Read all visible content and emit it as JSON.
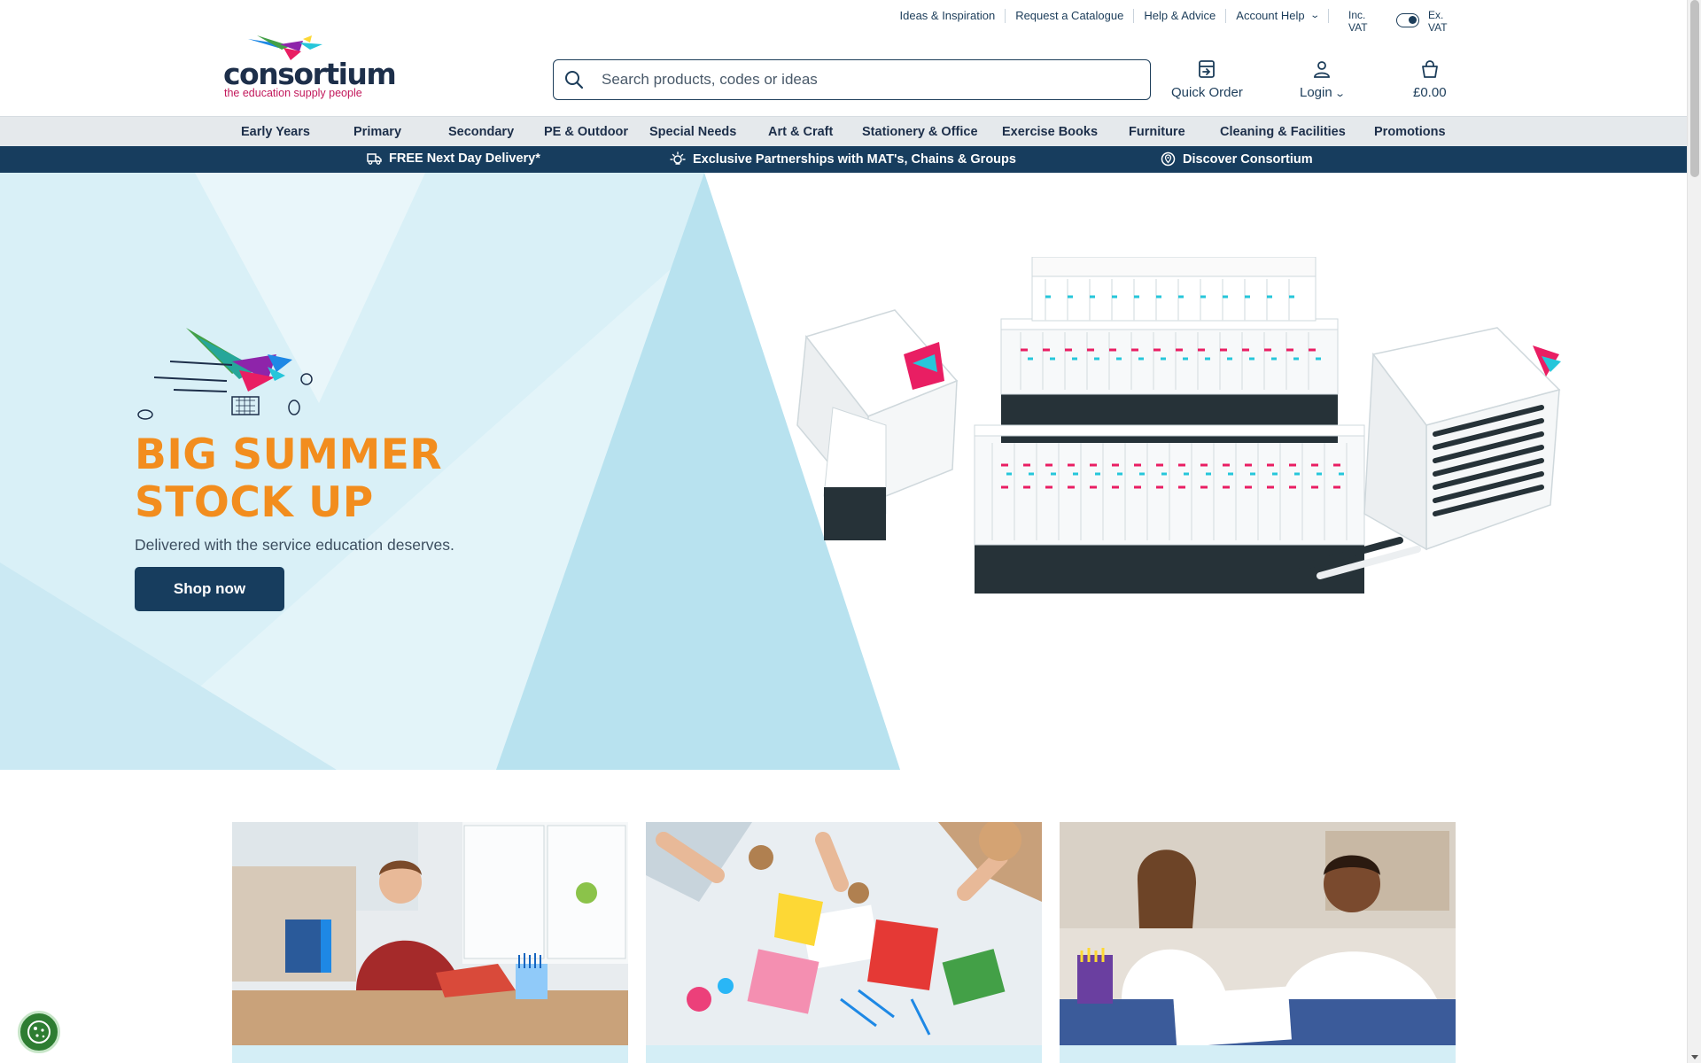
{
  "utility_bar": {
    "links": [
      "Ideas & Inspiration",
      "Request a Catalogue",
      "Help & Advice",
      "Account Help"
    ],
    "vat_inc_label": "Inc. VAT",
    "vat_ex_label": "Ex. VAT"
  },
  "header": {
    "logo_text": "consortium",
    "logo_tagline": "the education supply people",
    "search_placeholder": "Search products, codes or ideas",
    "search_value": "",
    "quick_order_label": "Quick Order",
    "login_label": "Login",
    "basket_total": "£0.00"
  },
  "category_nav": {
    "items": [
      "Early Years",
      "Primary",
      "Secondary",
      "PE & Outdoor",
      "Special Needs",
      "Art & Craft",
      "Stationery & Office",
      "Exercise Books",
      "Furniture",
      "Cleaning & Facilities",
      "Promotions"
    ]
  },
  "usp_bar": {
    "items": [
      "FREE Next Day Delivery*",
      "Exclusive Partnerships with MAT's, Chains & Groups",
      "Discover Consortium"
    ]
  },
  "hero": {
    "title_line1": "BIG SUMMER",
    "title_line2": "STOCK UP",
    "subtitle": "Delivered with the service education deserves.",
    "cta_label": "Shop now"
  },
  "colors": {
    "navy": "#173d5e",
    "orange": "#f28d1e",
    "light_blue": "#d4eef6",
    "logo_pink": "#c2185b"
  },
  "icons": [
    "search-icon",
    "quick-order-icon",
    "user-icon",
    "basket-icon",
    "delivery-truck-icon",
    "lightbulb-icon",
    "location-pin-icon",
    "cookie-icon",
    "chevron-down-icon"
  ]
}
